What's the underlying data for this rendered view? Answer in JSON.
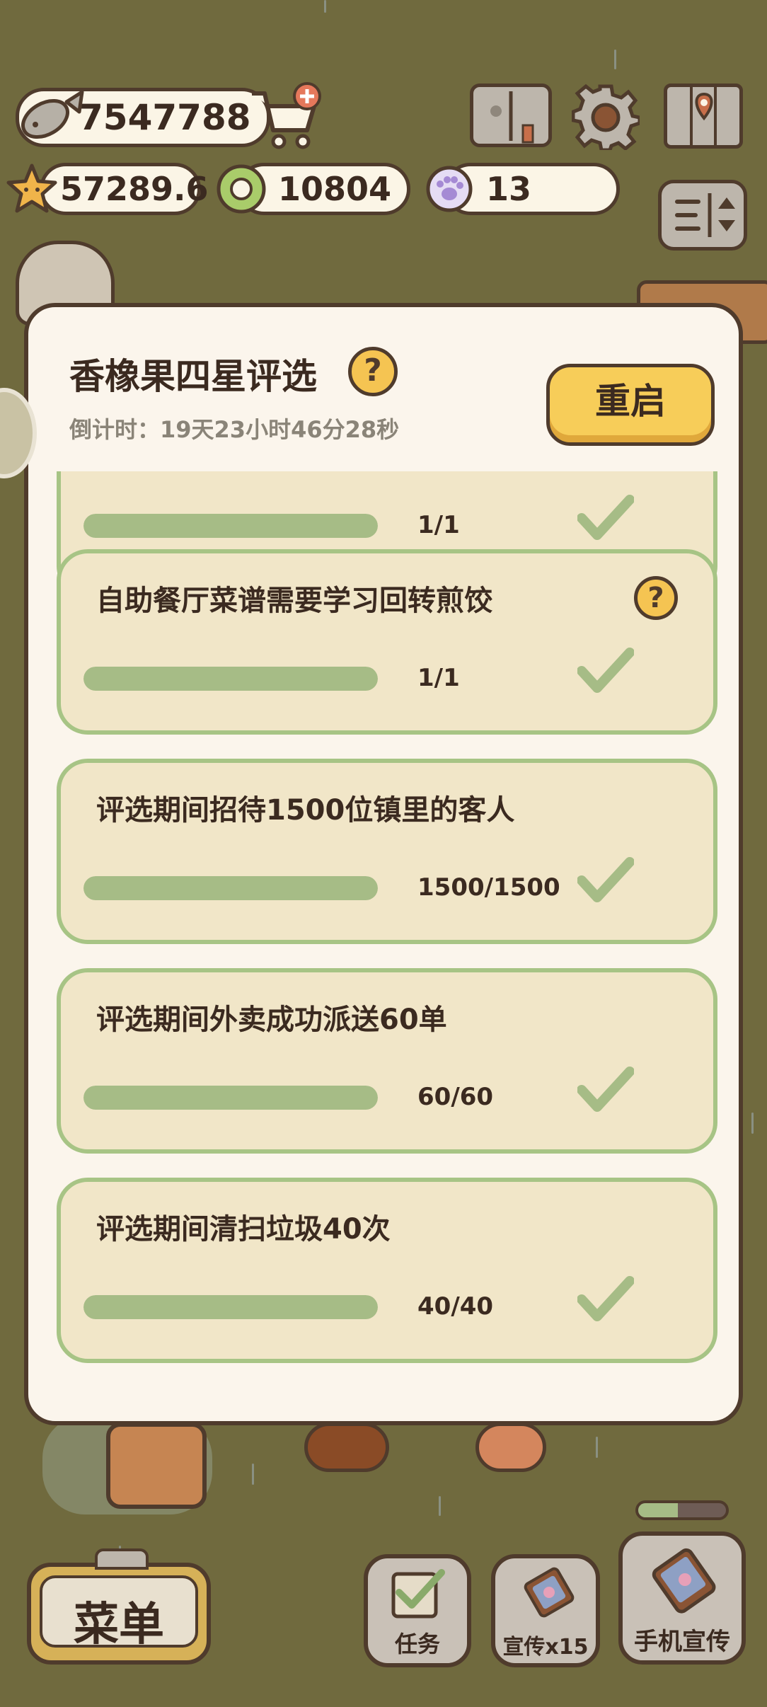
{
  "hud": {
    "fish_coins": "7547788",
    "stars": "57289.6",
    "green_currency": "10804",
    "paw_tokens": "13"
  },
  "modal": {
    "title": "香橡果四星评选",
    "countdown": "倒计时：19天23小时46分28秒",
    "restart_label": "重启",
    "tasks": [
      {
        "label": "",
        "progress_text": "1/1",
        "progress": 1.0,
        "completed": true
      },
      {
        "label": "自助餐厅菜谱需要学习回转煎饺",
        "progress_text": "1/1",
        "progress": 1.0,
        "completed": true,
        "has_help": true
      },
      {
        "label": "评选期间招待1500位镇里的客人",
        "progress_text": "1500/1500",
        "progress": 1.0,
        "completed": true
      },
      {
        "label": "评选期间外卖成功派送60单",
        "progress_text": "60/60",
        "progress": 1.0,
        "completed": true
      },
      {
        "label": "评选期间清扫垃圾40次",
        "progress_text": "40/40",
        "progress": 1.0,
        "completed": true
      }
    ]
  },
  "bottom_bar": {
    "menu_label": "菜单",
    "tasks_label": "任务",
    "promote_label": "宣传x15",
    "phone_promote_label": "手机宣传",
    "phone_promote_progress": 0.45
  },
  "icons": {
    "currency_fish": "fish-icon",
    "shop": "cart-plus-icon",
    "recipe_book": "book-icon",
    "settings": "gear-icon",
    "map": "map-icon",
    "star_currency": "star-icon",
    "green_currency": "green-ring-icon",
    "paw_currency": "paw-icon",
    "sort": "sort-icon",
    "check": "check-icon",
    "help": "question-icon"
  },
  "colors": {
    "background": "#706a3e",
    "panel": "#fbf5ec",
    "task_card": "#f1e6c8",
    "task_border": "#a7c485",
    "progress_fill": "#a6bc86",
    "restart_button": "#f7cd59",
    "outline": "#4f3b2c"
  }
}
